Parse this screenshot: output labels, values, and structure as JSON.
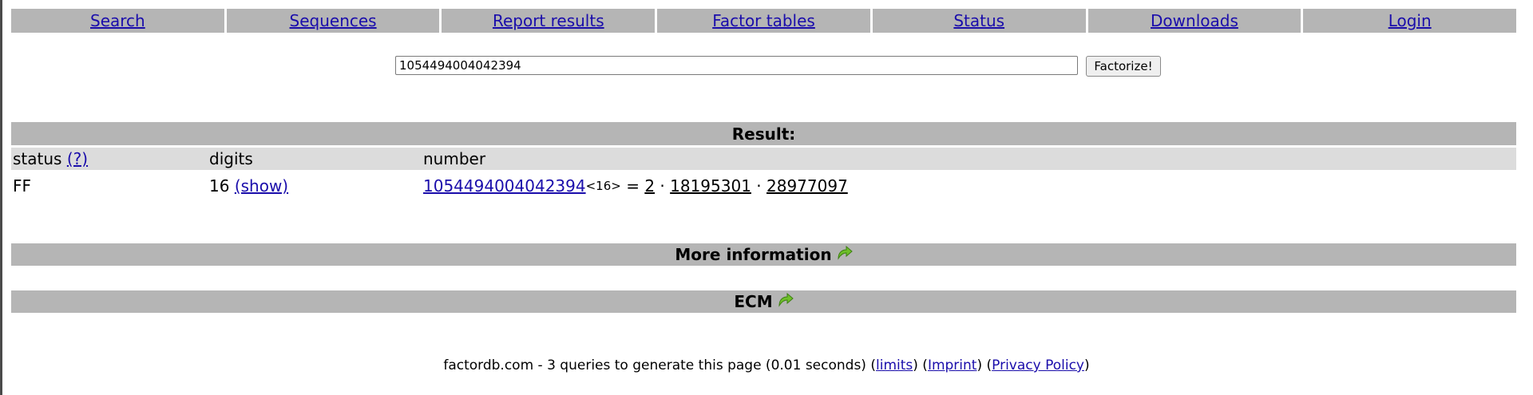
{
  "nav": {
    "items": [
      "Search",
      "Sequences",
      "Report results",
      "Factor tables",
      "Status",
      "Downloads",
      "Login"
    ]
  },
  "search": {
    "value": "1054494004042394",
    "button_label": "Factorize!"
  },
  "result": {
    "title": "Result:",
    "headers": {
      "status": "status",
      "status_help": "(?)",
      "digits": "digits",
      "number": "number"
    },
    "row": {
      "status": "FF",
      "digits": "16",
      "show_label": "(show)",
      "number": "1054494004042394",
      "digit_count": "<16>",
      "equals": "=",
      "factors": [
        "2",
        "18195301",
        "28977097"
      ],
      "separator": "·"
    }
  },
  "more_information": {
    "title": "More information"
  },
  "ecm": {
    "title": "ECM"
  },
  "footer": {
    "text": "factordb.com - 3 queries to generate this page (0.01 seconds)",
    "links": [
      "limits",
      "Imprint",
      "Privacy Policy"
    ]
  },
  "colors": {
    "bar": "#b5b5b5",
    "header_row": "#dcdcdc",
    "link": "#1a0dab",
    "arrow": "#6fbf2a"
  },
  "icons": {
    "more_information": "green-arrow-icon",
    "ecm": "green-arrow-icon"
  }
}
